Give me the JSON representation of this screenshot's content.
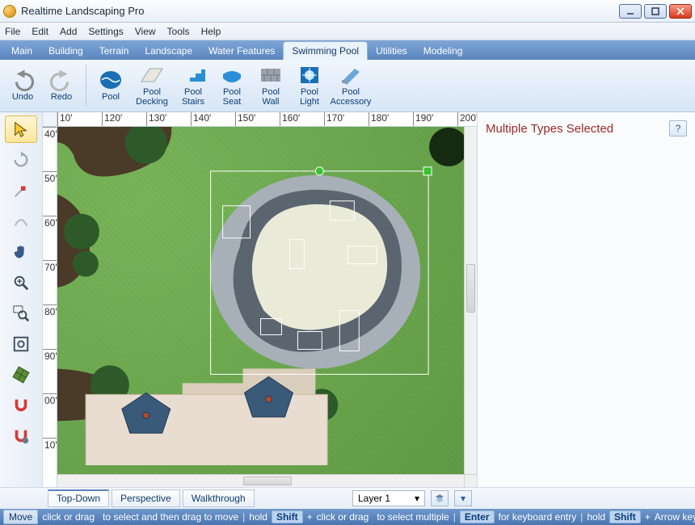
{
  "window": {
    "title": "Realtime Landscaping Pro"
  },
  "menu": {
    "items": [
      "File",
      "Edit",
      "Add",
      "Settings",
      "View",
      "Tools",
      "Help"
    ]
  },
  "tabs": {
    "items": [
      "Main",
      "Building",
      "Terrain",
      "Landscape",
      "Water Features",
      "Swimming Pool",
      "Utilities",
      "Modeling"
    ],
    "active_index": 5
  },
  "ribbon": {
    "undo": "Undo",
    "redo": "Redo",
    "pool": "Pool",
    "decking": "Pool\nDecking",
    "stairs": "Pool\nStairs",
    "seat": "Pool\nSeat",
    "wall": "Pool\nWall",
    "light": "Pool\nLight",
    "accessory": "Pool\nAccessory"
  },
  "ruler": {
    "h": [
      "10'",
      "120'",
      "130'",
      "140'",
      "150'",
      "160'",
      "170'",
      "180'",
      "190'",
      "200'"
    ],
    "v": [
      "40'",
      "50'",
      "60'",
      "70'",
      "80'",
      "90'",
      "00'",
      "10'"
    ]
  },
  "panel": {
    "title": "Multiple Types Selected",
    "help": "?"
  },
  "viewtabs": {
    "items": [
      "Top-Down",
      "Perspective",
      "Walkthrough"
    ],
    "active_index": 0
  },
  "layer": {
    "label": "Layer 1"
  },
  "status": {
    "move": "Move",
    "seg1a": "click or drag",
    "seg1b": "to select and then drag to move",
    "hold": "hold",
    "shift": "Shift",
    "plus": "+",
    "seg2a": "click or drag",
    "seg2b": "to select multiple",
    "enter": "Enter",
    "seg3": "for keyboard entry",
    "seg4": "Arrow key to nudge"
  }
}
